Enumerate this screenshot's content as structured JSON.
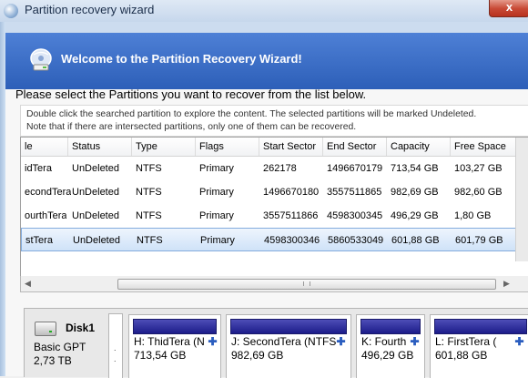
{
  "window": {
    "title": "Partition recovery wizard",
    "close_label": "x"
  },
  "header": {
    "welcome": "Welcome to the Partition Recovery Wizard!",
    "icon": "cd-wizard-icon"
  },
  "instruction": "Please select the Partitions you want to recover from the list below.",
  "info_lines": [
    "Double click the searched partition to explore the content. The selected partitions will be marked Undeleted.",
    "Note that if there are intersected partitions, only one of them can be recovered."
  ],
  "table": {
    "columns": [
      "le",
      "Status",
      "Type",
      "Flags",
      "Start Sector",
      "End Sector",
      "Capacity",
      "Free Space"
    ],
    "rows": [
      [
        "idTera",
        "UnDeleted",
        "NTFS",
        "Primary",
        "262178",
        "1496670179",
        "713,54 GB",
        "103,27 GB"
      ],
      [
        "econdTera",
        "UnDeleted",
        "NTFS",
        "Primary",
        "1496670180",
        "3557511865",
        "982,69 GB",
        "982,60 GB"
      ],
      [
        "ourthTera",
        "UnDeleted",
        "NTFS",
        "Primary",
        "3557511866",
        "4598300345",
        "496,29 GB",
        "1,80 GB"
      ],
      [
        "stTera",
        "UnDeleted",
        "NTFS",
        "Primary",
        "4598300346",
        "5860533049",
        "601,88 GB",
        "601,79 GB"
      ]
    ],
    "selected_row": 3
  },
  "disk": {
    "name": "Disk1",
    "type": "Basic GPT",
    "size": "2,73 TB",
    "partitions": [
      {
        "label": "H: ThidTera (N",
        "size": "713,54 GB"
      },
      {
        "label": "J: SecondTera (NTFS",
        "size": "982,69 GB"
      },
      {
        "label": "K: Fourth",
        "size": "496,29 GB"
      },
      {
        "label": "L: FirstTera (",
        "size": "601,88 GB"
      }
    ]
  },
  "colors": {
    "header_blue": "#2d5fb8",
    "selection": "#cfe2f8",
    "partition_bar": "#1c1c8a"
  }
}
